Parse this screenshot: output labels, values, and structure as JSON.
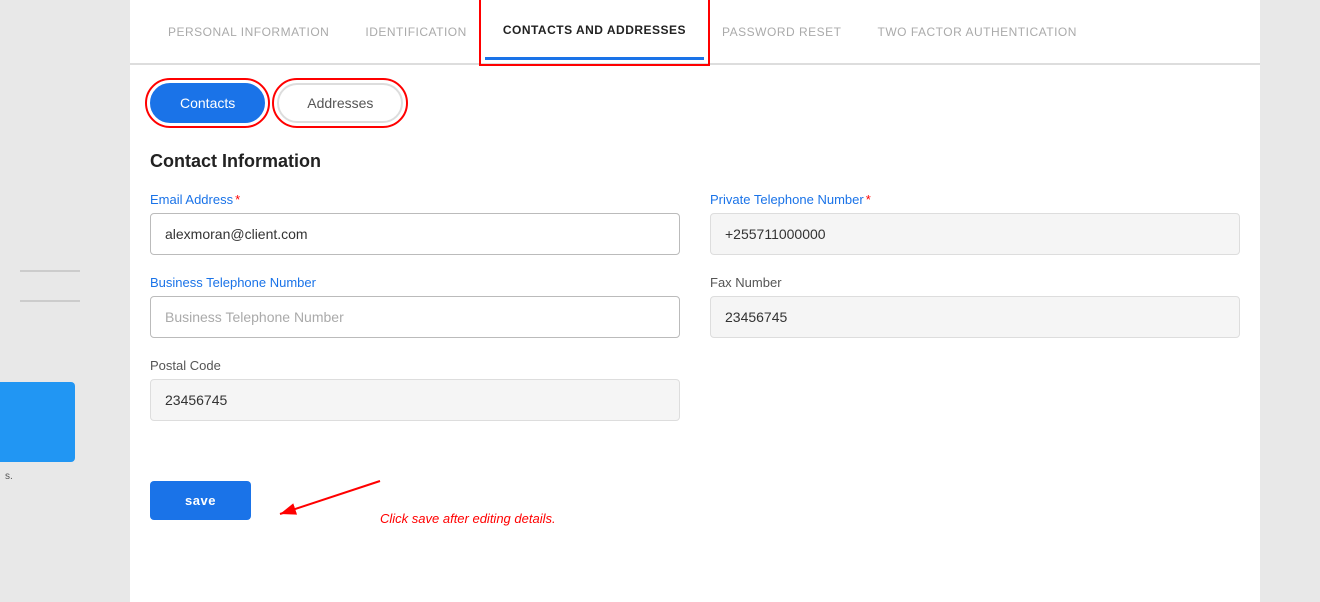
{
  "tabs": [
    {
      "id": "personal",
      "label": "PERSONAL INFORMATION",
      "active": false
    },
    {
      "id": "identification",
      "label": "IDENTIFICATION",
      "active": false
    },
    {
      "id": "contacts",
      "label": "CONTACTS AND ADDRESSES",
      "active": true
    },
    {
      "id": "password",
      "label": "PASSWORD RESET",
      "active": false
    },
    {
      "id": "twofactor",
      "label": "TWO FACTOR AUTHENTICATION",
      "active": false
    }
  ],
  "toggleButtons": [
    {
      "id": "contacts-btn",
      "label": "Contacts",
      "active": true
    },
    {
      "id": "addresses-btn",
      "label": "Addresses",
      "active": false
    }
  ],
  "formTitle": "Contact Information",
  "fields": {
    "emailAddress": {
      "label": "Email Address",
      "required": true,
      "value": "alexmoran@client.com",
      "placeholder": "Email Address",
      "editable": true
    },
    "privateTelephone": {
      "label": "Private Telephone Number",
      "required": true,
      "value": "+255711000000",
      "placeholder": "Private Telephone Number",
      "editable": false
    },
    "businessTelephone": {
      "label": "Business Telephone Number",
      "required": false,
      "value": "",
      "placeholder": "Business Telephone Number",
      "editable": true
    },
    "faxNumber": {
      "label": "Fax Number",
      "required": false,
      "value": "23456745",
      "placeholder": "Fax Number",
      "editable": false
    },
    "postalCode": {
      "label": "Postal Code",
      "required": false,
      "value": "23456745",
      "placeholder": "Postal Code",
      "editable": false
    }
  },
  "saveButton": {
    "label": "save"
  },
  "annotation": "Click save after editing details."
}
